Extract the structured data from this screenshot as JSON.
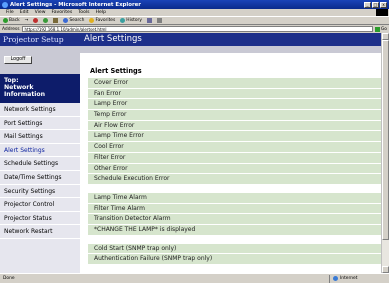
{
  "window": {
    "title": "Alert Settings - Microsoft Internet Explorer",
    "buttons": [
      "_",
      "□",
      "x"
    ]
  },
  "menu": [
    "File",
    "Edit",
    "View",
    "Favorites",
    "Tools",
    "Help"
  ],
  "toolbar": {
    "back": "Back",
    "forward": "→",
    "search": "Search",
    "favorites": "Favorites",
    "history": "History"
  },
  "address": {
    "label": "Address",
    "url": "https://192.168.1.10/admin/alertset.html",
    "go": "Go"
  },
  "sidebar": {
    "logo": "Projector Setup",
    "logoff": "Logoff",
    "top_line1": "Top:",
    "top_line2": "Network",
    "top_line3": "Information",
    "items": [
      {
        "label": "Network Settings"
      },
      {
        "label": "Port Settings"
      },
      {
        "label": "Mail Settings"
      },
      {
        "label": "Alert Settings"
      },
      {
        "label": "Schedule Settings"
      },
      {
        "label": "Date/Time Settings"
      },
      {
        "label": "Security Settings"
      },
      {
        "label": "Projector Control"
      },
      {
        "label": "Projector Status"
      },
      {
        "label": "Network Restart"
      }
    ]
  },
  "main": {
    "header": "Alert Settings",
    "section_title": "Alert Settings",
    "group1": [
      "Cover Error",
      "Fan Error",
      "Lamp Error",
      "Temp Error",
      "Air Flow Error",
      "Lamp Time Error",
      "Cool Error",
      "Filter Error",
      "Other Error",
      "Schedule Execution Error"
    ],
    "group2": [
      "Lamp Time Alarm",
      "Filter Time Alarm",
      "Transition Detector Alarm",
      "*CHANGE THE LAMP* is displayed"
    ],
    "group3": [
      "Cold Start (SNMP trap only)",
      "Authentication Failure (SNMP trap only)"
    ]
  },
  "status": {
    "text": "Done",
    "zone": "Internet"
  },
  "colors": {
    "nav_dark": "#1d2f8a",
    "row_green": "#d6e5cd",
    "sidebar_bg": "#e6e6ee"
  }
}
